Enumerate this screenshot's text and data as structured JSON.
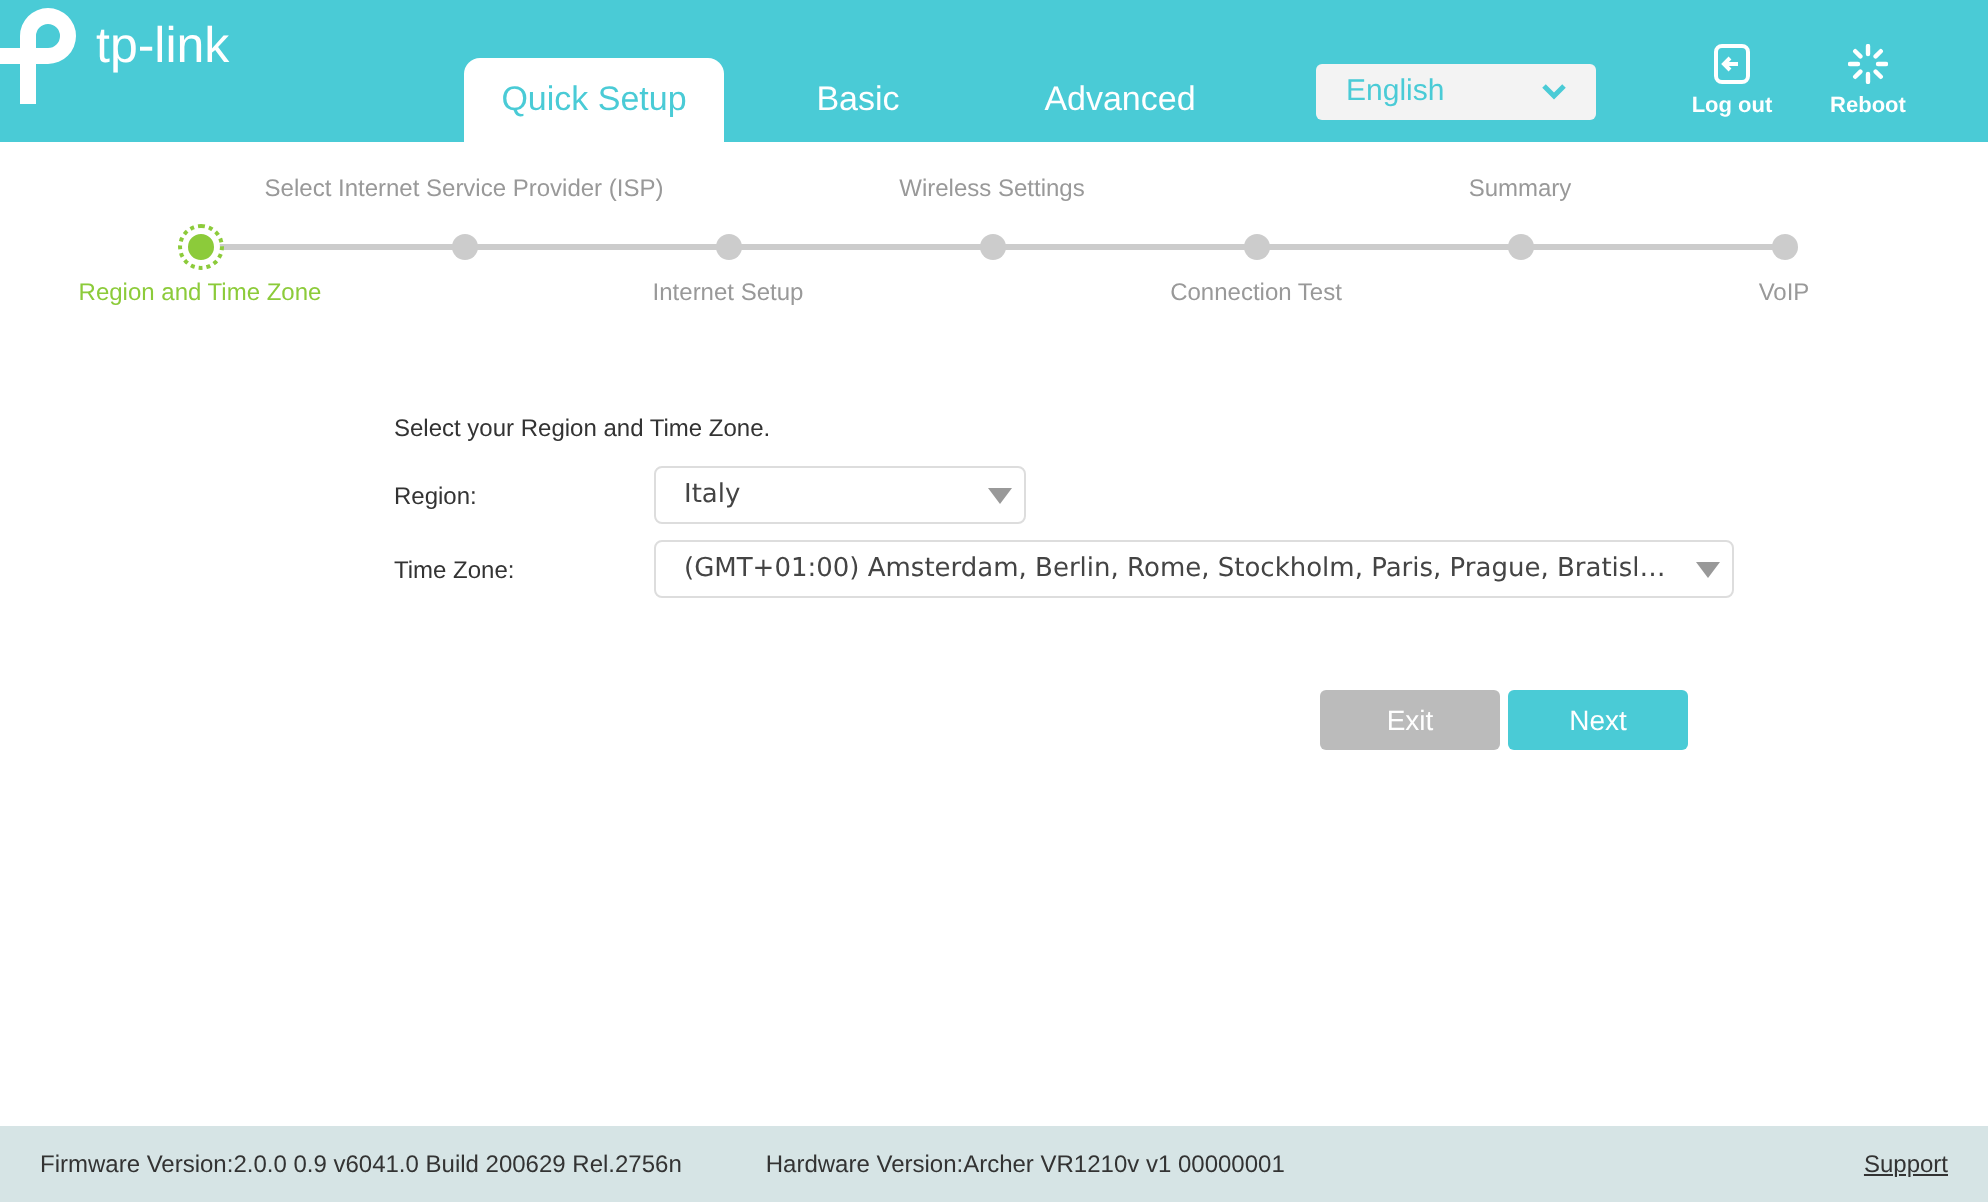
{
  "header": {
    "logo": "tp-link",
    "tabs": [
      {
        "label": "Quick Setup",
        "selected": true
      },
      {
        "label": "Basic",
        "selected": false
      },
      {
        "label": "Advanced",
        "selected": false
      }
    ],
    "language": "English",
    "actions": [
      {
        "kind": "logout",
        "label": "Log out"
      },
      {
        "kind": "reboot",
        "label": "Reboot"
      }
    ]
  },
  "steps": [
    {
      "label": "Region and Time Zone",
      "selected": true
    },
    {
      "label": "Select Internet Service Provider (ISP)",
      "selected": false
    },
    {
      "label": "Internet Setup",
      "selected": false
    },
    {
      "label": "Wireless Settings",
      "selected": false
    },
    {
      "label": "Connection Test",
      "selected": false
    },
    {
      "label": "Summary",
      "selected": false
    },
    {
      "label": "VoIP",
      "selected": false
    }
  ],
  "form": {
    "intro": "Select your Region and Time Zone.",
    "fields": [
      {
        "label": "Region:",
        "value": "Italy"
      },
      {
        "label": "Time Zone:",
        "value": "(GMT+01:00) Amsterdam, Berlin, Rome, Stockholm, Paris, Prague, Bratisl…"
      }
    ],
    "buttons": [
      {
        "kind": "secondary",
        "label": "Exit"
      },
      {
        "kind": "primary",
        "label": "Next"
      }
    ]
  },
  "footer": {
    "firmware": "Firmware Version:2.0.0 0.9 v6041.0 Build 200629 Rel.2756n",
    "hardware": "Hardware Version:Archer VR1210v v1 00000001",
    "support": "Support"
  }
}
